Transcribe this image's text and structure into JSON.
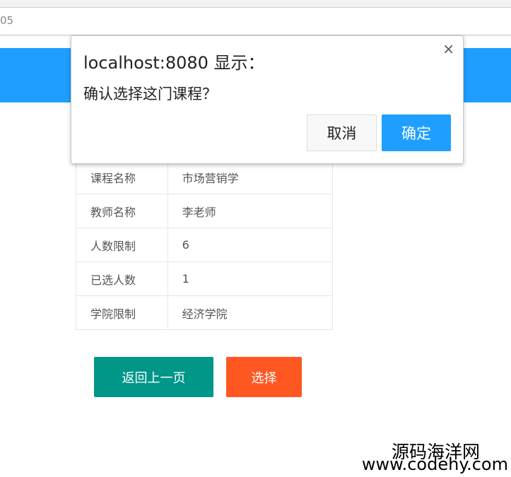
{
  "browser": {
    "url_fragment": "05"
  },
  "dialog": {
    "title": "localhost:8080 显示：",
    "message": "确认选择这门课程？",
    "close_glyph": "×",
    "cancel_label": "取消",
    "ok_label": "确定"
  },
  "course_info": [
    {
      "key": "课程名称",
      "value": "市场营销学"
    },
    {
      "key": "教师名称",
      "value": "李老师"
    },
    {
      "key": "人数限制",
      "value": "6"
    },
    {
      "key": "已选人数",
      "value": "1"
    },
    {
      "key": "学院限制",
      "value": "经济学院"
    }
  ],
  "actions": {
    "back_label": "返回上一页",
    "select_label": "选择"
  },
  "watermark": {
    "line1": "源码海洋网",
    "line2": "www.codehy.com"
  },
  "colors": {
    "header_blue": "#1e9fff",
    "back_button": "#009688",
    "select_button": "#ff5722",
    "ok_button": "#1e9fff"
  }
}
